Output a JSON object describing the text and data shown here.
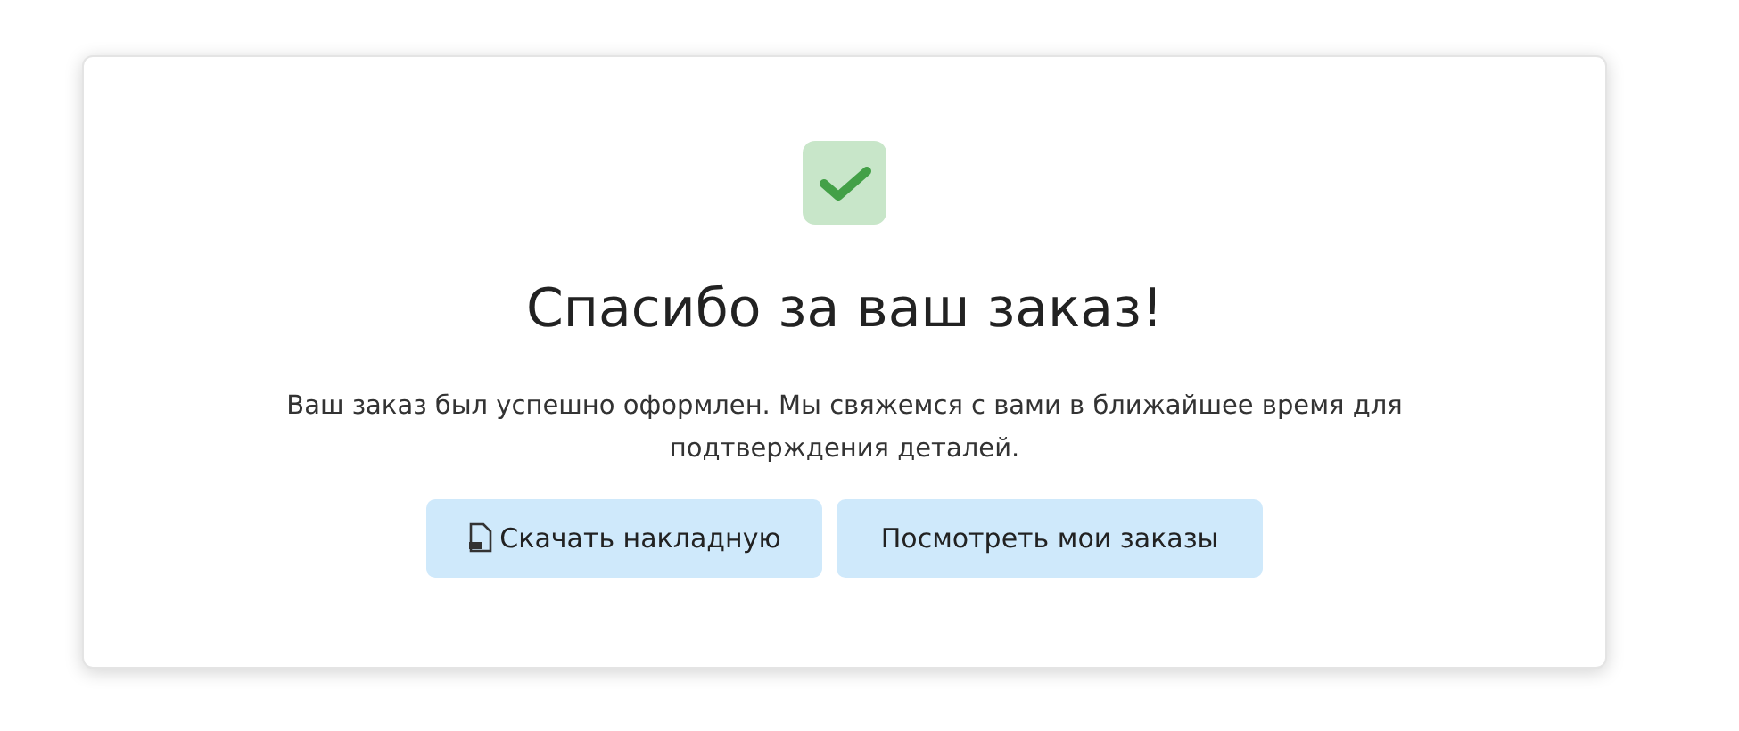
{
  "title": "Спасибо за ваш заказ!",
  "message": "Ваш заказ был успешно оформлен. Мы свяжемся с вами в ближайшее время для подтверждения деталей.",
  "buttons": [
    {
      "label": "Скачать накладную",
      "kind": "iconed"
    },
    {
      "label": "Посмотреть мои заказы",
      "kind": "plain"
    }
  ]
}
